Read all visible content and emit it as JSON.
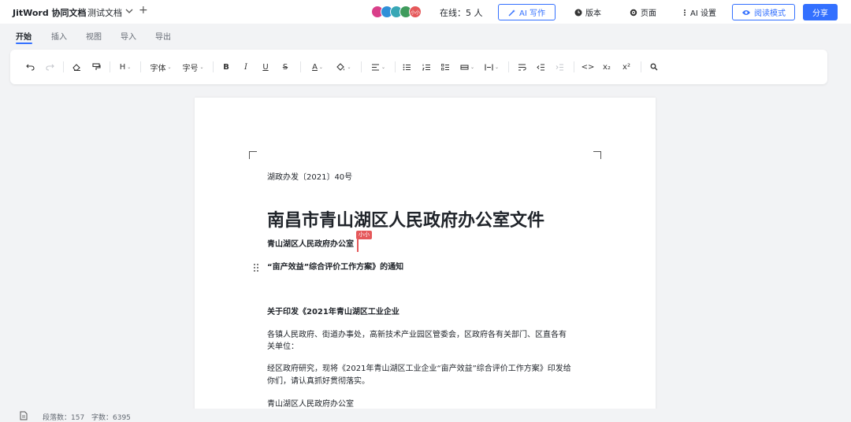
{
  "app": {
    "title": "JitWord 协同文档"
  },
  "document": {
    "name": "测试文档"
  },
  "header": {
    "online_label": "在线：5 人",
    "avatars": [
      {
        "label": "",
        "color": "#d93f8a"
      },
      {
        "label": "",
        "color": "#2f8fd8"
      },
      {
        "label": "",
        "color": "#37a7b5"
      },
      {
        "label": "",
        "color": "#3f9b5c"
      },
      {
        "label": "小小",
        "color": "#e5585a"
      }
    ],
    "ai_write": "AI 写作",
    "version": "版本",
    "page": "页面",
    "ai_settings": "AI 设置",
    "read_mode": "阅读模式",
    "share": "分享"
  },
  "menu": {
    "tabs": [
      {
        "label": "开始",
        "active": true
      },
      {
        "label": "插入",
        "active": false
      },
      {
        "label": "视图",
        "active": false
      },
      {
        "label": "导入",
        "active": false
      },
      {
        "label": "导出",
        "active": false
      }
    ]
  },
  "toolbar": {
    "heading": "H",
    "font_family": "字体",
    "font_size": "字号",
    "bold": "B",
    "italic": "I",
    "underline": "U",
    "strike": "S",
    "font_color": "A",
    "subscript": "x₂",
    "superscript": "x²",
    "code": "<>"
  },
  "content": {
    "doc_number": "湖政办发〔2021〕40号",
    "title": "南昌市青山湖区人民政府办公室文件",
    "issuer": "青山湖区人民政府办公室",
    "collab_user": "小小",
    "notice": "“亩产效益”综合评价工作方案》的通知",
    "subject": "关于印发《2021年青山湖区工业企业",
    "body_line_1": "各镇人民政府、街道办事处，高新技术产业园区管委会，区政府各有关部门、区直各有",
    "body_line_2": "关单位：",
    "body_line_3": "经区政府研究，现将《2021年青山湖区工业企业“亩产效益”综合评价工作方案》印发给",
    "body_line_4": "你们，请认真抓好贯彻落实。",
    "signature": "青山湖区人民政府办公室"
  },
  "status": {
    "paragraphs": "段落数：157",
    "words": "字数：6395"
  },
  "colors": {
    "accent": "#3370ff",
    "cursor": "#e5585a",
    "background": "#f2f3f5"
  }
}
